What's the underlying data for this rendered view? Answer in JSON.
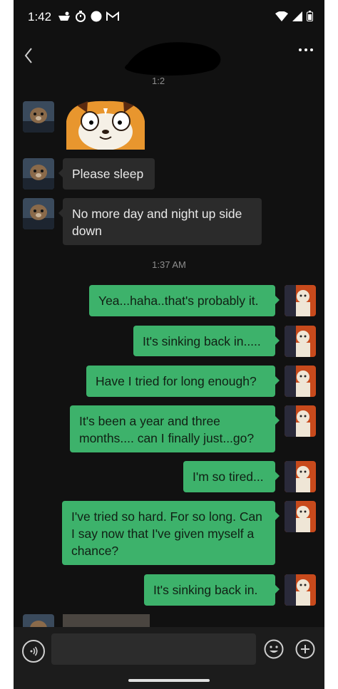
{
  "status_bar": {
    "time": "1:42"
  },
  "header": {
    "timestamp_partial": "1:2"
  },
  "timestamp_2": "1:37 AM",
  "messages_left": [
    {
      "text": "Please sleep"
    },
    {
      "text": "No more day and night up side down"
    }
  ],
  "messages_right": [
    {
      "text": "Yea...haha..that's probably it."
    },
    {
      "text": "It's sinking back in....."
    },
    {
      "text": "Have I tried for long enough?"
    },
    {
      "text": "It's been a year and three months.... can I finally just...go?"
    },
    {
      "text": "I'm so tired..."
    },
    {
      "text": "I've tried so hard. For so long. Can I say now that I've given myself a chance?"
    },
    {
      "text": "It's sinking back in."
    }
  ],
  "input": {
    "value": ""
  },
  "colors": {
    "accent": "#3db26b",
    "background": "#111111",
    "bubble_left": "#2b2b2b"
  }
}
